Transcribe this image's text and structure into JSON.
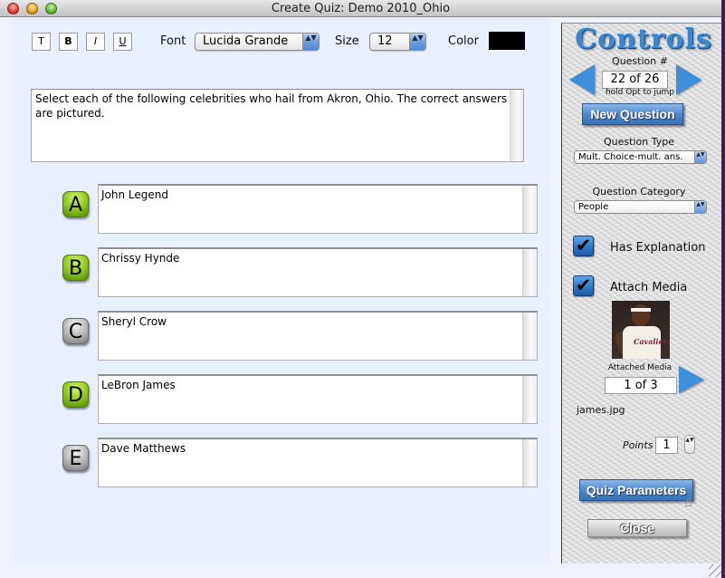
{
  "window": {
    "title": "Create Quiz: Demo 2010_Ohio",
    "buttons": [
      "close",
      "minimize",
      "zoom"
    ]
  },
  "toolbar": {
    "format_buttons": [
      {
        "name": "plain",
        "label": "T"
      },
      {
        "name": "bold",
        "label": "B"
      },
      {
        "name": "italic",
        "label": "I"
      },
      {
        "name": "underline",
        "label": "U"
      }
    ],
    "font_label": "Font",
    "font_value": "Lucida Grande",
    "size_label": "Size",
    "size_value": "12",
    "color_label": "Color",
    "color_value": "#000000",
    "popup_arrows": "▲▼"
  },
  "question": {
    "text": "Select each of the following celebrities who hail from Akron, Ohio. The correct answers are pictured."
  },
  "answers": [
    {
      "letter": "A",
      "text": "John Legend",
      "correct": true
    },
    {
      "letter": "B",
      "text": "Chrissy Hynde",
      "correct": true
    },
    {
      "letter": "C",
      "text": "Sheryl Crow",
      "correct": false
    },
    {
      "letter": "D",
      "text": "LeBron James",
      "correct": true
    },
    {
      "letter": "E",
      "text": "Dave Matthews",
      "correct": false
    }
  ],
  "controls": {
    "title": "Controls",
    "question_number_label": "Question #",
    "question_number_value": "22 of 26",
    "question_number_hint": "hold Opt to jump",
    "new_question_label": "New Question",
    "question_type_label": "Question Type",
    "question_type_value": "Mult. Choice-mult. ans.",
    "question_category_label": "Question Category",
    "question_category_value": "People",
    "has_explanation_label": "Has Explanation",
    "has_explanation_checked": true,
    "attach_media_label": "Attach Media",
    "attach_media_checked": true,
    "check_glyph": "✔",
    "media_thumb_caption": "Cavaliers",
    "attached_media_label": "Attached Media",
    "attached_media_value": "1 of 3",
    "media_filename": "james.jpg",
    "points_label": "Points",
    "points_value": "1",
    "stepper_glyph": "▲▼",
    "quiz_parameters_label": "Quiz Parameters",
    "close_label": "Close",
    "cursor_glyph": "☝"
  }
}
